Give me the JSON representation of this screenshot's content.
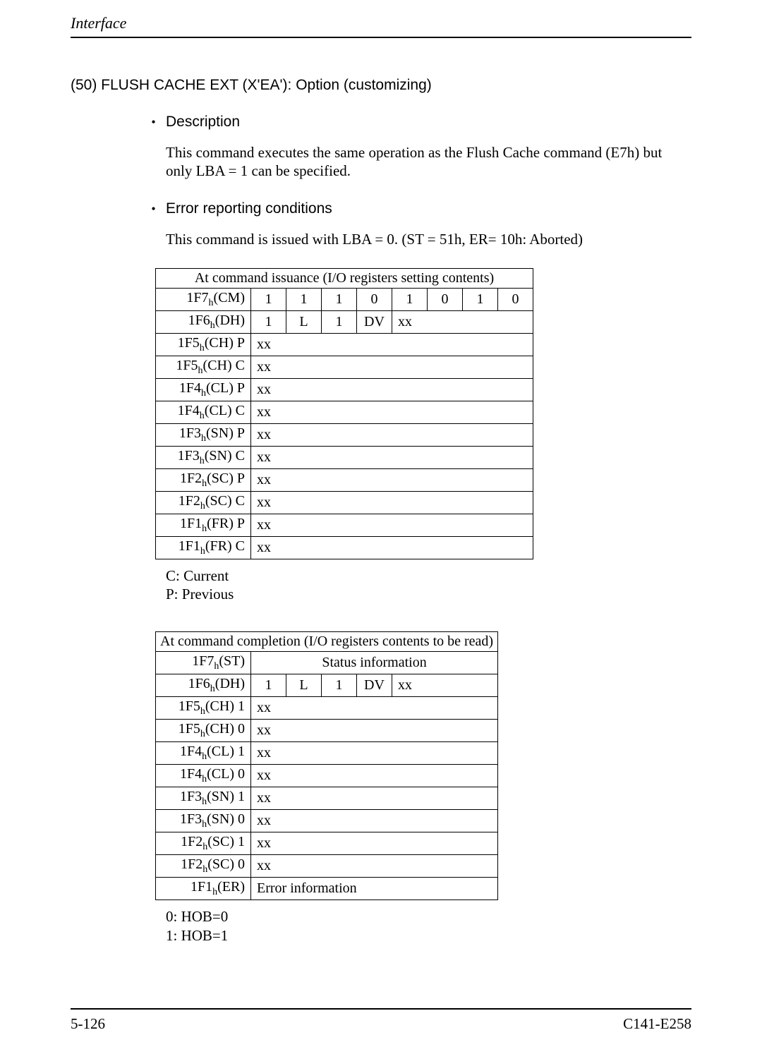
{
  "running_head": "Interface",
  "section": {
    "num_title": "(50)  FLUSH CACHE EXT (X'EA'):  Option (customizing)"
  },
  "desc": {
    "heading": "Description",
    "para": "This command executes the same operation as the Flush Cache command (E7h) but only LBA = 1 can be specified."
  },
  "err": {
    "heading": "Error reporting conditions",
    "para": "This command is issued with LBA = 0.  (ST = 51h, ER= 10h:  Aborted)"
  },
  "table1": {
    "caption": "At command issuance (I/O registers setting contents)",
    "rows": {
      "cm": {
        "label_pre": "1F7",
        "label_suf": "(CM)",
        "bits": [
          "1",
          "1",
          "1",
          "0",
          "1",
          "0",
          "1",
          "0"
        ]
      },
      "dh": {
        "label_pre": "1F6",
        "label_suf": "(DH)",
        "bits": [
          "1",
          "L",
          "1",
          "DV",
          "xx"
        ]
      },
      "chp": {
        "label_pre": "1F5",
        "label_suf": "(CH) P",
        "val": "xx"
      },
      "chc": {
        "label_pre": "1F5",
        "label_suf": "(CH) C",
        "val": "xx"
      },
      "clp": {
        "label_pre": "1F4",
        "label_suf": "(CL) P",
        "val": "xx"
      },
      "clc": {
        "label_pre": "1F4",
        "label_suf": "(CL) C",
        "val": "xx"
      },
      "snp": {
        "label_pre": "1F3",
        "label_suf": "(SN) P",
        "val": "xx"
      },
      "snc": {
        "label_pre": "1F3",
        "label_suf": "(SN) C",
        "val": "xx"
      },
      "scp": {
        "label_pre": "1F2",
        "label_suf": "(SC) P",
        "val": "xx"
      },
      "scc": {
        "label_pre": "1F2",
        "label_suf": "(SC) C",
        "val": "xx"
      },
      "frp": {
        "label_pre": "1F1",
        "label_suf": "(FR) P",
        "val": "xx"
      },
      "frc": {
        "label_pre": "1F1",
        "label_suf": "(FR) C",
        "val": "xx"
      }
    },
    "legend_c": "C:  Current",
    "legend_p": "P:  Previous"
  },
  "table2": {
    "caption": "At command completion (I/O registers contents to be read)",
    "rows": {
      "st": {
        "label_pre": "1F7",
        "label_suf": "(ST)",
        "status": "Status information"
      },
      "dh": {
        "label_pre": "1F6",
        "label_suf": "(DH)",
        "bits": [
          "1",
          "L",
          "1",
          "DV",
          "xx"
        ]
      },
      "ch1": {
        "label_pre": "1F5",
        "label_suf": "(CH) 1",
        "val": "xx"
      },
      "ch0": {
        "label_pre": "1F5",
        "label_suf": "(CH) 0",
        "val": "xx"
      },
      "cl1": {
        "label_pre": "1F4",
        "label_suf": "(CL) 1",
        "val": "xx"
      },
      "cl0": {
        "label_pre": "1F4",
        "label_suf": "(CL) 0",
        "val": "xx"
      },
      "sn1": {
        "label_pre": "1F3",
        "label_suf": "(SN) 1",
        "val": "xx"
      },
      "sn0": {
        "label_pre": "1F3",
        "label_suf": "(SN) 0",
        "val": "xx"
      },
      "sc1": {
        "label_pre": "1F2",
        "label_suf": "(SC) 1",
        "val": "xx"
      },
      "sc0": {
        "label_pre": "1F2",
        "label_suf": "(SC) 0",
        "val": "xx"
      },
      "er": {
        "label_pre": "1F1",
        "label_suf": "(ER)",
        "err": "Error information"
      }
    },
    "legend_0": "0:  HOB=0",
    "legend_1": "1:  HOB=1"
  },
  "footer": {
    "left": "5-126",
    "right": "C141-E258"
  },
  "glyph": {
    "hsub": "h"
  }
}
